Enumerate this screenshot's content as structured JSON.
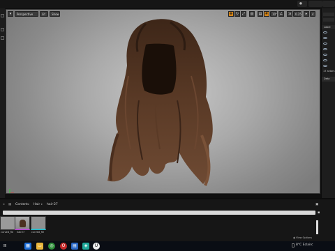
{
  "viewport": {
    "perspective_label": "Perspective",
    "lit_label": "Lit",
    "show_label": "Show",
    "grid_snap_value": "10°",
    "scale_value": "0.25",
    "camera_speed": "4"
  },
  "content_browser": {
    "path": [
      "Content",
      "Hair",
      "hair-27"
    ],
    "view_options_label": "View Options",
    "assets": [
      {
        "name": "curved_fle"
      },
      {
        "name": "hair27"
      },
      {
        "name": "curved_fle"
      }
    ]
  },
  "right_panel": {
    "header_label": "Label",
    "count_text": "17 actors",
    "details_label": "Deta"
  },
  "taskbar": {
    "tray_text": "8°C  Eclairc"
  },
  "colors": {
    "accent_orange": "#d48418",
    "viewport_bg": "#b3b3b3",
    "hair_dark": "#2a1a10",
    "hair_mid": "#5a3a25"
  }
}
